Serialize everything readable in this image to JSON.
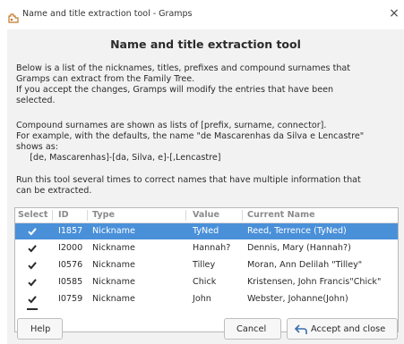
{
  "window": {
    "title": "Name and title extraction tool - Gramps",
    "close_icon": "×"
  },
  "heading": "Name and title extraction tool",
  "description": {
    "lines1": [
      "Below is a list of the nicknames, titles, prefixes and compound surnames that",
      "Gramps can extract from the Family Tree.",
      "If you accept the changes, Gramps will modify the entries that have been",
      "selected."
    ],
    "lines2": [
      "Compound surnames are shown as lists of [prefix, surname, connector].",
      "For example, with the defaults, the name \"de Mascarenhas da Silva e Lencastre\"",
      "shows as:",
      "     [de, Mascarenhas]-[da, Silva, e]-[,Lencastre]"
    ],
    "lines3": [
      "Run this tool several times to correct names that have multiple information that",
      "can be extracted."
    ]
  },
  "table": {
    "headers": {
      "select": "Select",
      "id": "ID",
      "type": "Type",
      "value": "Value",
      "current_name": "Current Name"
    },
    "rows": [
      {
        "checked": true,
        "id": "I1857",
        "type": "Nickname",
        "value": "TyNed",
        "current_name": "Reed, Terrence (TyNed)",
        "selected": true
      },
      {
        "checked": true,
        "id": "I2000",
        "type": "Nickname",
        "value": "Hannah?",
        "current_name": "Dennis, Mary (Hannah?)",
        "selected": false
      },
      {
        "checked": true,
        "id": "I0576",
        "type": "Nickname",
        "value": "Tilley",
        "current_name": "Moran, Ann Delilah \"Tilley\"",
        "selected": false
      },
      {
        "checked": true,
        "id": "I0585",
        "type": "Nickname",
        "value": "Chick",
        "current_name": "Kristensen, John Francis\"Chick\"",
        "selected": false
      },
      {
        "checked": true,
        "id": "I0759",
        "type": "Nickname",
        "value": "John",
        "current_name": "Webster, Johanne(John)",
        "selected": false
      }
    ]
  },
  "buttons": {
    "help": "Help",
    "cancel": "Cancel",
    "accept": "Accept and close"
  },
  "colors": {
    "selection": "#4a90d9",
    "background": "#f2f2f2"
  }
}
